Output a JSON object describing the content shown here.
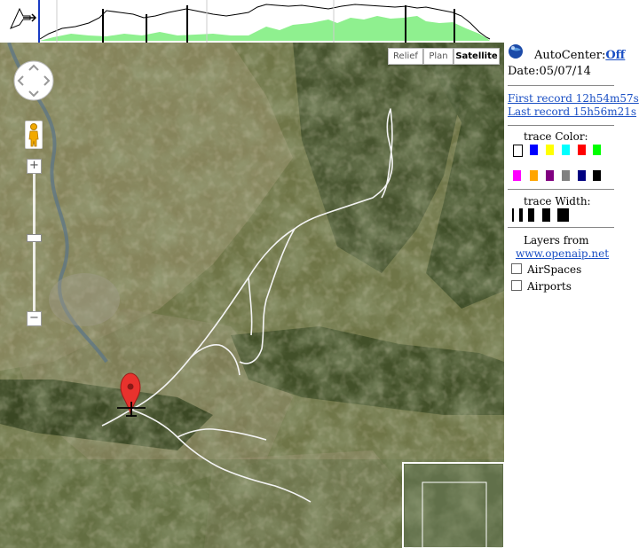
{
  "profile": {
    "icon": "pointer-arrow-icon"
  },
  "map": {
    "type_buttons": [
      "Relief",
      "Plan",
      "Satellite"
    ],
    "active_type": "Satellite",
    "pan_icon": "pan-control-icon",
    "pegman_icon": "street-view-pegman-icon",
    "zoom_in": "+",
    "zoom_out": "−",
    "marker_icon": "map-pin-icon",
    "glider_icon": "glider-icon"
  },
  "panel": {
    "globe_icon": "google-earth-globe-icon",
    "autocenter_label": "AutoCenter:",
    "autocenter_value": "Off",
    "date_label": "Date:05/07/14",
    "first_record": "First record 12h54m57s",
    "last_record": "Last record 15h56m21s",
    "trace_color_label": "trace Color:",
    "colors": [
      "#ffffff",
      "#0000ff",
      "#ffff00",
      "#00ffff",
      "#ff0000",
      "#00ff00",
      "#ff00ff",
      "#ffa500",
      "#800080",
      "#808080",
      "#000080",
      "#000000"
    ],
    "trace_width_label": "trace Width:",
    "layers_label": "Layers from",
    "layers_link": "www.openaip.net",
    "airspaces_label": "AirSpaces",
    "airports_label": "Airports"
  }
}
